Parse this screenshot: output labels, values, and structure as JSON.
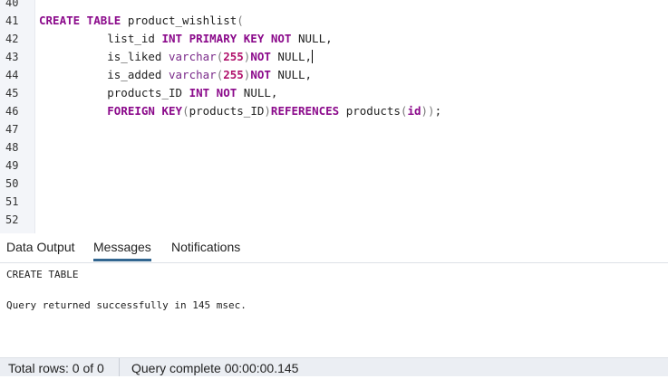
{
  "editor": {
    "lines": [
      {
        "num": "40",
        "tokens": []
      },
      {
        "num": "41",
        "tokens": [
          {
            "t": "CREATE TABLE",
            "c": "kw"
          },
          {
            "t": " product_wishlist",
            "c": "id"
          },
          {
            "t": "(",
            "c": "paren"
          }
        ]
      },
      {
        "num": "42",
        "tokens": [
          {
            "t": "          list_id ",
            "c": "id"
          },
          {
            "t": "INT PRIMARY KEY NOT",
            "c": "kw"
          },
          {
            "t": " NULL,",
            "c": "id"
          }
        ]
      },
      {
        "num": "43",
        "tokens": [
          {
            "t": "          is_liked ",
            "c": "id"
          },
          {
            "t": "varchar",
            "c": "fn"
          },
          {
            "t": "(",
            "c": "paren"
          },
          {
            "t": "255",
            "c": "num"
          },
          {
            "t": ")",
            "c": "paren"
          },
          {
            "t": "NOT",
            "c": "kw"
          },
          {
            "t": " NULL,",
            "c": "id"
          },
          {
            "caret": true
          }
        ]
      },
      {
        "num": "44",
        "tokens": [
          {
            "t": "          is_added ",
            "c": "id"
          },
          {
            "t": "varchar",
            "c": "fn"
          },
          {
            "t": "(",
            "c": "paren"
          },
          {
            "t": "255",
            "c": "num"
          },
          {
            "t": ")",
            "c": "paren"
          },
          {
            "t": "NOT",
            "c": "kw"
          },
          {
            "t": " NULL,",
            "c": "id"
          }
        ]
      },
      {
        "num": "45",
        "tokens": [
          {
            "t": "          products_ID ",
            "c": "id"
          },
          {
            "t": "INT NOT",
            "c": "kw"
          },
          {
            "t": " NULL,",
            "c": "id"
          }
        ]
      },
      {
        "num": "46",
        "tokens": [
          {
            "t": "          ",
            "c": "id"
          },
          {
            "t": "FOREIGN KEY",
            "c": "kw"
          },
          {
            "t": "(",
            "c": "paren"
          },
          {
            "t": "products_ID",
            "c": "id"
          },
          {
            "t": ")",
            "c": "paren"
          },
          {
            "t": "REFERENCES",
            "c": "kw"
          },
          {
            "t": " products",
            "c": "id"
          },
          {
            "t": "(",
            "c": "paren"
          },
          {
            "t": "id",
            "c": "kw"
          },
          {
            "t": "))",
            "c": "paren"
          },
          {
            "t": ";",
            "c": "punc"
          }
        ]
      },
      {
        "num": "47",
        "tokens": []
      },
      {
        "num": "48",
        "tokens": []
      },
      {
        "num": "49",
        "tokens": []
      },
      {
        "num": "50",
        "tokens": []
      },
      {
        "num": "51",
        "tokens": []
      },
      {
        "num": "52",
        "tokens": []
      }
    ]
  },
  "tabs": {
    "data_output": "Data Output",
    "messages": "Messages",
    "notifications": "Notifications"
  },
  "messages": {
    "line1": "CREATE TABLE",
    "line2": "Query returned successfully in 145 msec."
  },
  "status": {
    "total_rows": "Total rows: 0 of 0",
    "query_complete": "Query complete 00:00:00.145"
  }
}
